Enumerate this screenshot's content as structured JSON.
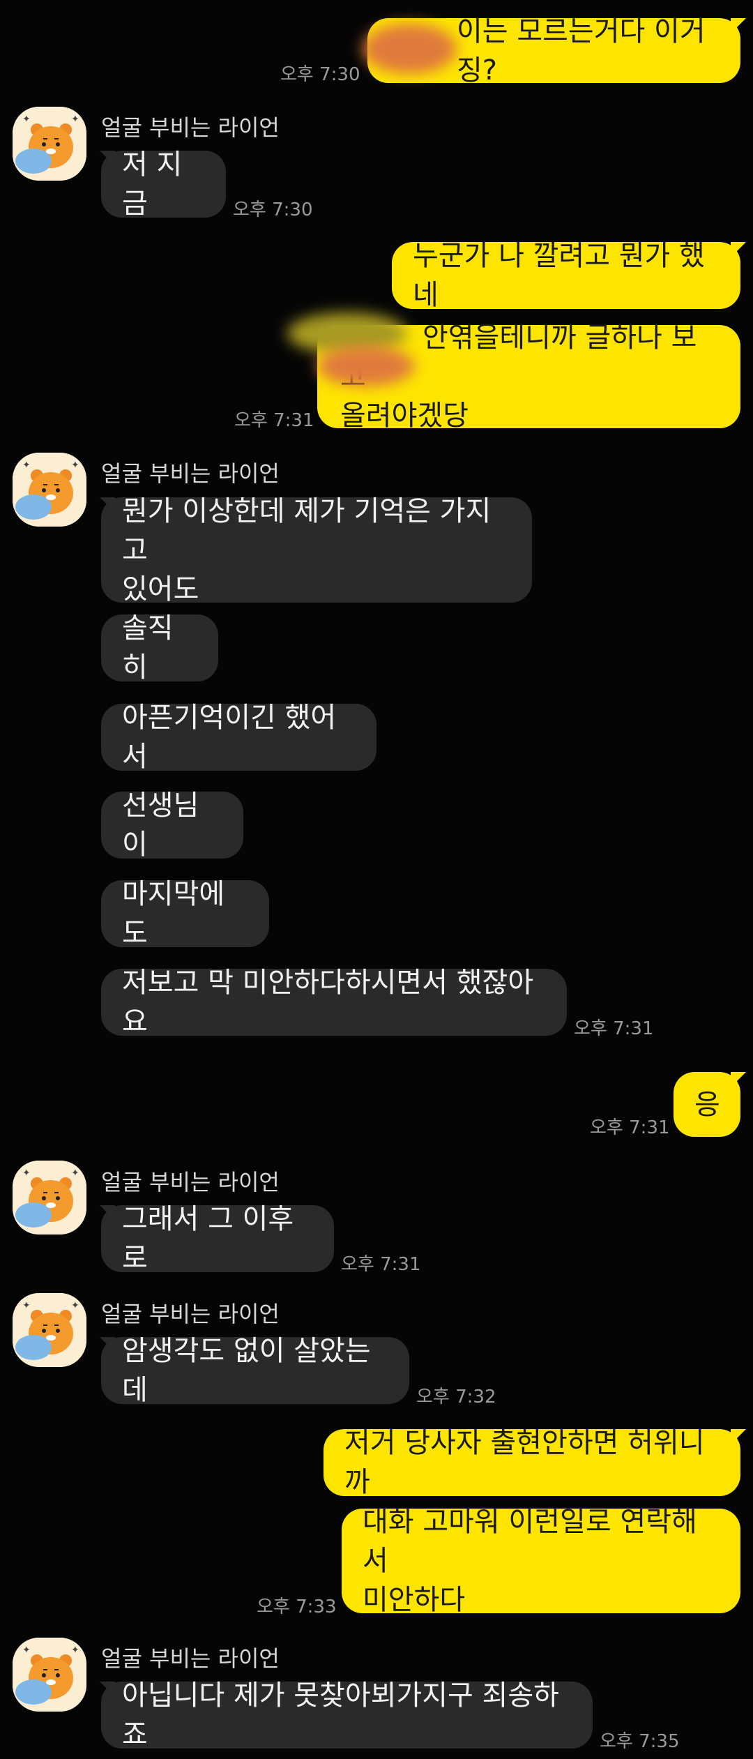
{
  "sender_name": "얼굴 부비는 라이언",
  "colors": {
    "background": "#050505",
    "incoming_bubble": "#2a2a2a",
    "outgoing_bubble": "#fee500",
    "timestamp": "#9a9a9a"
  },
  "avatar_icon": "ryan-character-icon",
  "messages": [
    {
      "dir": "out",
      "text": "이는 모르는거다 이거징?",
      "time": "오후 7:30"
    },
    {
      "dir": "in",
      "text": "저 지금",
      "time": "오후 7:30"
    },
    {
      "dir": "out",
      "text": "누군가 나 깔려고 뭔가 했네",
      "time": ""
    },
    {
      "dir": "out",
      "text": "안엮을테니까 글하나 보고\n올려야겠당",
      "time": "오후 7:31"
    },
    {
      "dir": "in",
      "text": "뭔가 이상한데 제가 기억은 가지고\n있어도",
      "time": ""
    },
    {
      "dir": "in",
      "text": "솔직히",
      "time": ""
    },
    {
      "dir": "in",
      "text": "아픈기억이긴 했어서",
      "time": ""
    },
    {
      "dir": "in",
      "text": "선생님이",
      "time": ""
    },
    {
      "dir": "in",
      "text": "마지막에도",
      "time": ""
    },
    {
      "dir": "in",
      "text": "저보고 막 미안하다하시면서 했잖아요",
      "time": "오후 7:31"
    },
    {
      "dir": "out",
      "text": "응",
      "time": "오후 7:31"
    },
    {
      "dir": "in",
      "text": "그래서 그 이후로",
      "time": "오후 7:31"
    },
    {
      "dir": "in",
      "text": "암생각도 없이 살았는데",
      "time": "오후 7:32"
    },
    {
      "dir": "out",
      "text": "저거 당사자 출현안하면 허위니까",
      "time": ""
    },
    {
      "dir": "out",
      "text": "대화 고마워 이런일로 연락해서\n미안하다",
      "time": "오후 7:33"
    },
    {
      "dir": "in",
      "text": "아닙니다 제가 못찾아뵈가지구 죄송하죠",
      "time": "오후 7:35"
    }
  ]
}
